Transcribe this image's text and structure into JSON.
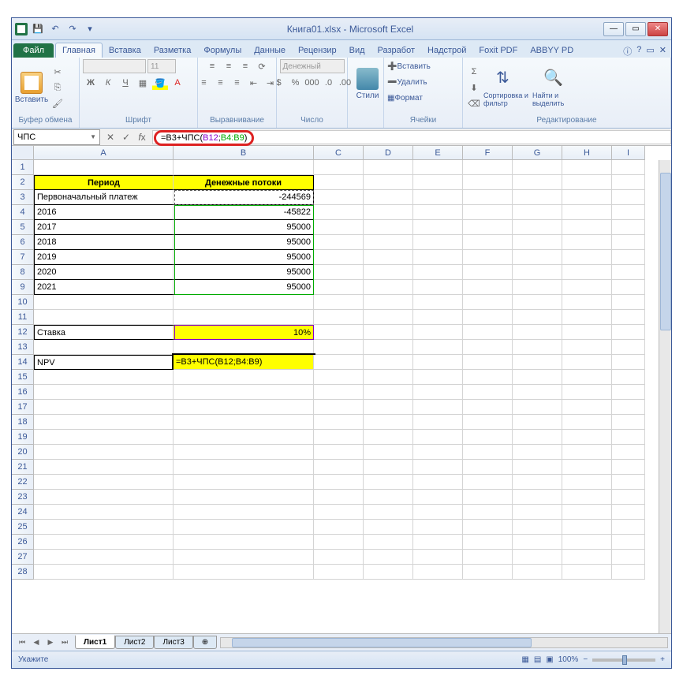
{
  "window": {
    "title": "Книга01.xlsx - Microsoft Excel"
  },
  "ribbon": {
    "file": "Файл",
    "tabs": [
      "Главная",
      "Вставка",
      "Разметка",
      "Формулы",
      "Данные",
      "Рецензир",
      "Вид",
      "Разработ",
      "Надстрой",
      "Foxit PDF",
      "ABBYY PD"
    ],
    "active_tab": 0,
    "groups": {
      "clipboard": {
        "label": "Буфер обмена",
        "paste": "Вставить"
      },
      "font": {
        "label": "Шрифт",
        "name": "",
        "size": "11"
      },
      "align": {
        "label": "Выравнивание"
      },
      "number": {
        "label": "Число",
        "format": "Денежный"
      },
      "styles": {
        "label": "",
        "btn": "Стили"
      },
      "cells": {
        "label": "Ячейки",
        "insert": "Вставить",
        "delete": "Удалить",
        "format": "Формат"
      },
      "editing": {
        "label": "Редактирование",
        "sort": "Сортировка и фильтр",
        "find": "Найти и выделить"
      }
    }
  },
  "namebox": "ЧПС",
  "formula": {
    "full": "=B3+ЧПС(B12;B4:B9)",
    "parts": {
      "p1": "=B3+ЧПС(",
      "p2": "B12",
      "p3": ";",
      "p4": "B4:B9",
      "p5": ")"
    }
  },
  "columns": [
    "A",
    "B",
    "C",
    "D",
    "E",
    "F",
    "G",
    "H",
    "I"
  ],
  "sheet": {
    "headers": {
      "A2": "Период",
      "B2": "Денежные потоки"
    },
    "rows": [
      {
        "A": "Первоначальный платеж",
        "B": "-244569"
      },
      {
        "A": "2016",
        "B": "-45822"
      },
      {
        "A": "2017",
        "B": "95000"
      },
      {
        "A": "2018",
        "B": "95000"
      },
      {
        "A": "2019",
        "B": "95000"
      },
      {
        "A": "2020",
        "B": "95000"
      },
      {
        "A": "2021",
        "B": "95000"
      }
    ],
    "rate_label": "Ставка",
    "rate_value": "10%",
    "npv_label": "NPV",
    "npv_formula": "=B3+ЧПС(B12;B4:B9)"
  },
  "tabs": [
    "Лист1",
    "Лист2",
    "Лист3"
  ],
  "status": {
    "mode": "Укажите",
    "zoom": "100%"
  }
}
